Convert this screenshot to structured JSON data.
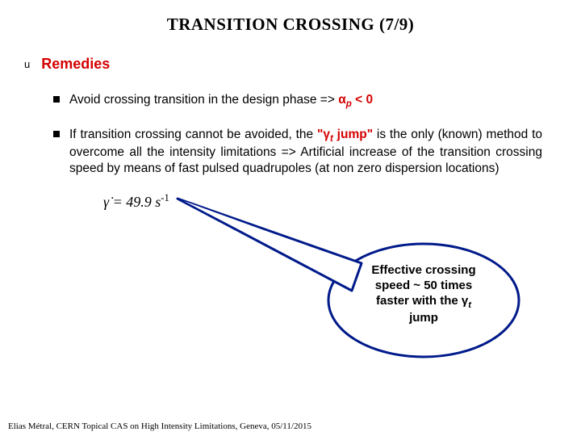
{
  "title": "TRANSITION CROSSING (7/9)",
  "section": {
    "marker": "u",
    "heading": "Remedies"
  },
  "bullets": {
    "b1": {
      "pre": "Avoid crossing transition in the design phase => ",
      "alpha": "α",
      "alpha_sub": "p",
      "post": " < 0"
    },
    "b2": {
      "p1": "If transition crossing cannot be avoided, the ",
      "q_open": "\"",
      "gamma": "γ",
      "gamma_sub": "t",
      "jump": " jump\"",
      "p2": " is the only (known) method to overcome all the intensity limitations => Artificial increase of the transition crossing speed by means of fast pulsed quadrupoles (at non zero dispersion locations)"
    }
  },
  "formula": {
    "gdot": "γ̇",
    "eq": " = 49.9 s",
    "exp": "-1"
  },
  "callout": {
    "l1": "Effective crossing",
    "l2": "speed ~ 50 times",
    "l3_pre": "faster with the ",
    "l3_gamma": "γ",
    "l3_sub": "t",
    "l4": "jump"
  },
  "footer": "Elias Métral, CERN Topical CAS on High Intensity Limitations, Geneva, 05/11/2015"
}
